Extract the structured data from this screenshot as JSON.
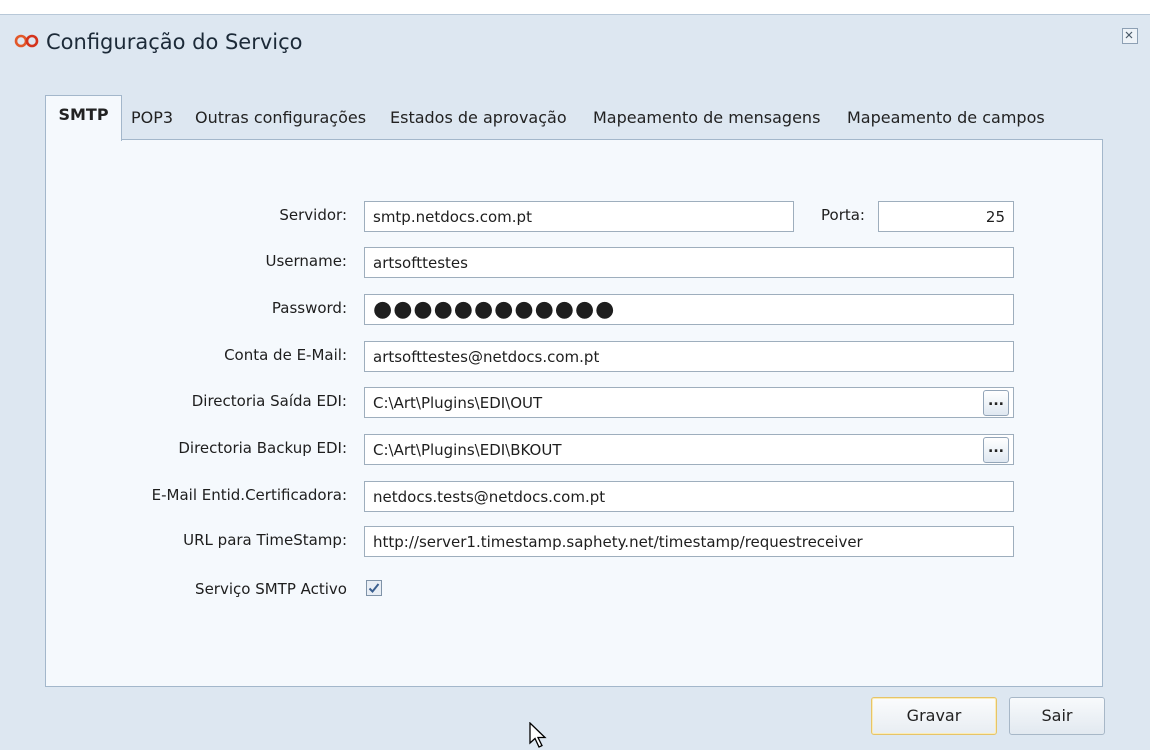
{
  "window": {
    "title": "Configuração do Serviço",
    "accent_color": "#e2582a"
  },
  "tabs": [
    {
      "label": "SMTP",
      "active": true
    },
    {
      "label": "POP3",
      "active": false
    },
    {
      "label": "Outras configurações",
      "active": false
    },
    {
      "label": "Estados de aprovação",
      "active": false
    },
    {
      "label": "Mapeamento de mensagens",
      "active": false
    },
    {
      "label": "Mapeamento de campos",
      "active": false
    }
  ],
  "form": {
    "servidor": {
      "label": "Servidor:",
      "value": "smtp.netdocs.com.pt"
    },
    "porta": {
      "label": "Porta:",
      "value": "25"
    },
    "username": {
      "label": "Username:",
      "value": "artsofttestes"
    },
    "password": {
      "label": "Password:",
      "value": "●●●●●●●●●●●●"
    },
    "conta_email": {
      "label": "Conta de E-Mail:",
      "value": "artsofttestes@netdocs.com.pt"
    },
    "dir_saida": {
      "label": "Directoria Saída EDI:",
      "value": "C:\\Art\\Plugins\\EDI\\OUT",
      "browse_label": "..."
    },
    "dir_backup": {
      "label": "Directoria Backup EDI:",
      "value": "C:\\Art\\Plugins\\EDI\\BKOUT",
      "browse_label": "..."
    },
    "email_certificadora": {
      "label": "E-Mail Entid.Certificadora:",
      "value": "netdocs.tests@netdocs.com.pt"
    },
    "url_timestamp": {
      "label": "URL para TimeStamp:",
      "value": "http://server1.timestamp.saphety.net/timestamp/requestreceiver"
    },
    "smtp_activo": {
      "label": "Serviço SMTP Activo",
      "checked": true
    }
  },
  "buttons": {
    "gravar": "Gravar",
    "sair": "Sair"
  }
}
